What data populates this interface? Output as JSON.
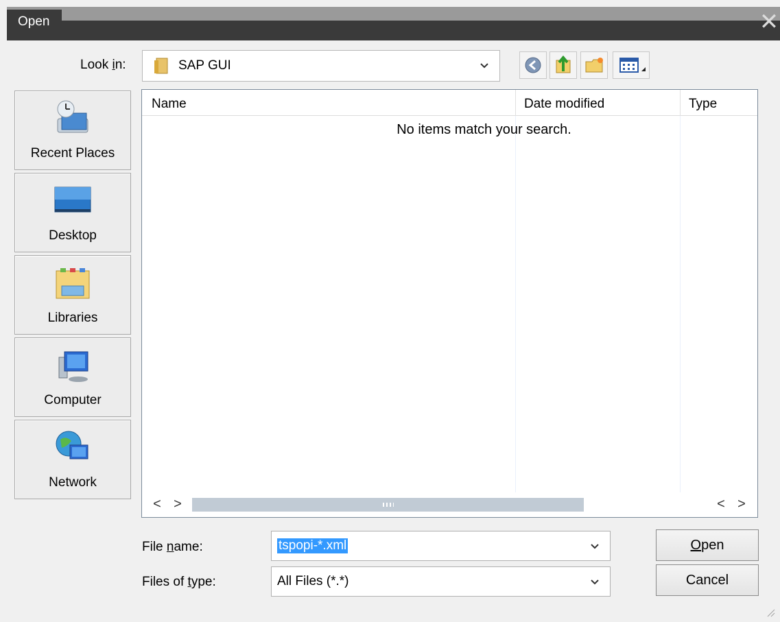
{
  "window": {
    "title": "Open",
    "close_glyph": "✕"
  },
  "look_in": {
    "label_pre": "Look ",
    "label_accel": "i",
    "label_post": "n:",
    "value": "SAP GUI",
    "icon": "folder-icon"
  },
  "toolbar": {
    "buttons": [
      {
        "name": "back-icon"
      },
      {
        "name": "up-folder-icon"
      },
      {
        "name": "new-folder-icon"
      },
      {
        "name": "view-menu-icon"
      }
    ]
  },
  "places": [
    {
      "label": "Recent Places",
      "icon": "recent-places-icon"
    },
    {
      "label": "Desktop",
      "icon": "desktop-icon"
    },
    {
      "label": "Libraries",
      "icon": "libraries-icon"
    },
    {
      "label": "Computer",
      "icon": "computer-icon"
    },
    {
      "label": "Network",
      "icon": "network-icon"
    }
  ],
  "file_list": {
    "columns": [
      "Name",
      "Date modified",
      "Type"
    ],
    "empty_message": "No items match your search.",
    "scroll_left": "<",
    "scroll_right": ">"
  },
  "file_name": {
    "label_pre": "File ",
    "label_accel": "n",
    "label_post": "ame:",
    "value": "tspopi-*.xml"
  },
  "file_type": {
    "label_pre": "Files of ",
    "label_accel": "t",
    "label_post": "ype:",
    "value": "All Files (*.*)"
  },
  "buttons": {
    "open_accel": "O",
    "open_rest": "pen",
    "cancel": "Cancel"
  },
  "colors": {
    "selection": "#3399ff",
    "title_bar": "#3a3a3a"
  }
}
